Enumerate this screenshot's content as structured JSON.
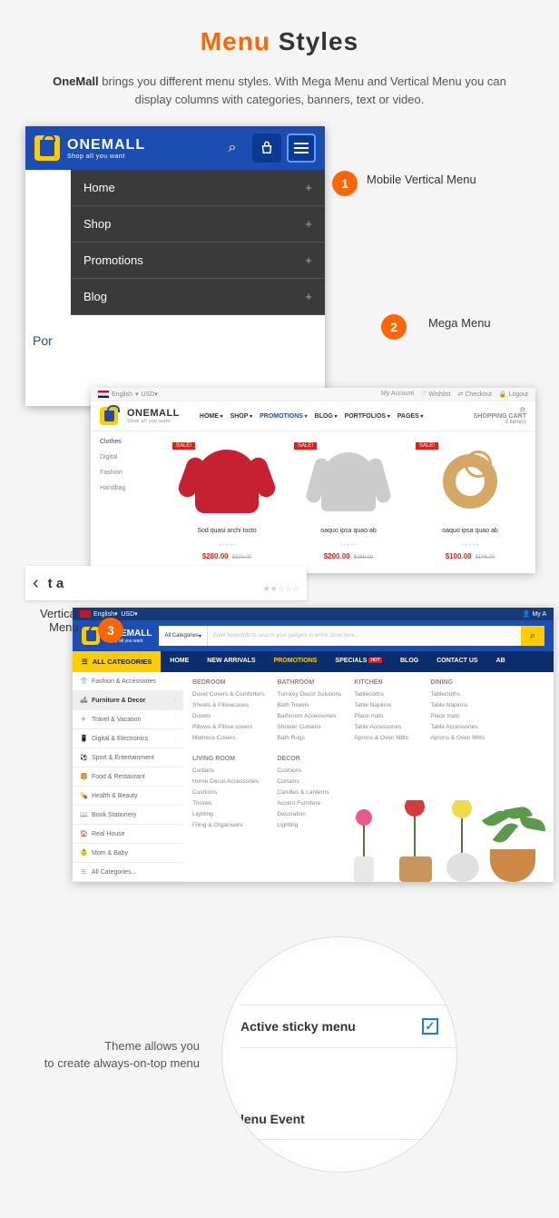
{
  "title": {
    "part1": "Menu",
    "part2": "Styles"
  },
  "intro": {
    "bold": "OneMall",
    "rest": " brings you different menu styles. With Mega Menu and Vertical Menu you can display columns with categories, banners, text or video."
  },
  "badges": {
    "b1": "1",
    "b2": "2",
    "b3": "3"
  },
  "labels": {
    "l1": "Mobile Vertical Menu",
    "l2": "Mega Menu",
    "l3a": "Vertical",
    "l3b": "Menu"
  },
  "mobile": {
    "brand": "ONEMALL",
    "tagline": "Shop all you want",
    "items": [
      "Home",
      "Shop",
      "Promotions",
      "Blog"
    ],
    "portfolio_peek": "Por"
  },
  "mega": {
    "topbar": {
      "lang": "English",
      "cur": "USD",
      "account": "My Account",
      "wishlist": "Wishlist",
      "checkout": "Checkout",
      "logout": "Logout"
    },
    "brand": "ONEMALL",
    "tagline": "Shop all you want",
    "nav": [
      "HOME",
      "SHOP",
      "PROMOTIONS",
      "BLOG",
      "PORTFOLIOS",
      "PAGES"
    ],
    "cart_label": "SHOPPING CART",
    "cart_items": "3 item(s)",
    "side": [
      "Clothes",
      "Digital",
      "Fashion",
      "Handbag"
    ],
    "products": [
      {
        "sale": "SALE!",
        "name": "Sod quasi archi tocto",
        "price": "$280.00",
        "old": "$320.00"
      },
      {
        "sale": "SALE!",
        "name": "oaquo ipsa quao ab",
        "price": "$200.00",
        "old": "$286.00"
      },
      {
        "sale": "SALE!",
        "name": "oaquo ipsa quao ab",
        "price": "$100.00",
        "old": "$146.00"
      }
    ],
    "peek_text": "t a"
  },
  "vertical": {
    "top": {
      "lang": "English",
      "cur": "USD",
      "account": "My A"
    },
    "brand": "ONEMALL",
    "tagline": "Shop all you want",
    "search_cat": "All Categories",
    "search_ph": "Enter keywords to search your gadgets in entire store here...",
    "allcat": "ALL CATEGORIES",
    "menubar": [
      "HOME",
      "NEW ARRIVALS",
      "PROMOTIONS",
      "SPECIALS",
      "BLOG",
      "CONTACT US",
      "AB"
    ],
    "hot": "HOT",
    "cats": [
      {
        "icon": "👕",
        "label": "Fashion & Accessories"
      },
      {
        "icon": "🛋",
        "label": "Furniture & Decor"
      },
      {
        "icon": "✈",
        "label": "Travel & Vacation"
      },
      {
        "icon": "📱",
        "label": "Digital & Electronics"
      },
      {
        "icon": "⚽",
        "label": "Sport & Entertainment"
      },
      {
        "icon": "🍔",
        "label": "Food & Restaurant"
      },
      {
        "icon": "💊",
        "label": "Health & Beauty"
      },
      {
        "icon": "📖",
        "label": "Book Stationery"
      },
      {
        "icon": "🏠",
        "label": "Real House"
      },
      {
        "icon": "👶",
        "label": "Mom & Baby"
      },
      {
        "icon": "☰",
        "label": "All Categories..."
      }
    ],
    "cols": {
      "bedroom": {
        "h": "BEDROOM",
        "items": [
          "Duvet Covers & Comforters",
          "Sheets & Pillowcases",
          "Duvets",
          "Pillows & Pillow covers",
          "Mattress Covers"
        ]
      },
      "living": {
        "h": "LIVING ROOM",
        "items": [
          "Curtains",
          "Home Decor Accessories",
          "Cushions",
          "Throws",
          "Lighting",
          "Filing & Organisers"
        ]
      },
      "bathroom": {
        "h": "BATHROOM",
        "items": [
          "Turnkey Decor Solutions",
          "Bath Towels",
          "Bathroom Accessories",
          "Shower Curtains",
          "Bath Rugs"
        ]
      },
      "decor": {
        "h": "DECOR",
        "items": [
          "Cushions",
          "Curtains",
          "Candles & Lanterns",
          "Accent Furniture",
          "Decoration",
          "Lighting"
        ]
      },
      "kitchen": {
        "h": "KITCHEN",
        "items": [
          "Tablecloths",
          "Table Napkins",
          "Place mats",
          "Table Accessories",
          "Aprons & Oven Mitts"
        ]
      },
      "dining": {
        "h": "DINING",
        "items": [
          "Tablecloths",
          "Table Napkins",
          "Place mats",
          "Table Accessories",
          "Aprons & Oven Mitts"
        ]
      }
    }
  },
  "sticky": {
    "desc1": "Theme allows you",
    "desc2": "to create always-on-top menu",
    "opt1": "Active sticky menu",
    "opt2": "lenu Event",
    "check": "✓"
  }
}
